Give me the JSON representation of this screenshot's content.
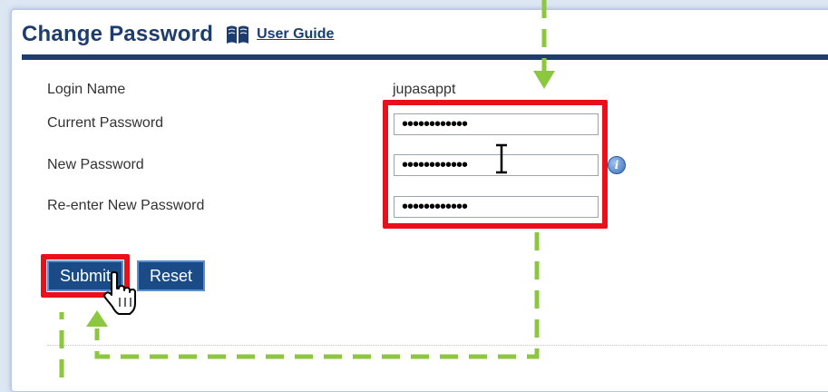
{
  "page": {
    "title": "Change Password",
    "user_guide": "User Guide"
  },
  "form": {
    "login_name_label": "Login Name",
    "login_name_value": "jupasappt",
    "current_password_label": "Current Password",
    "current_password_value": "••••••••••••",
    "new_password_label": "New Password",
    "new_password_value": "••••••••••••",
    "reenter_password_label": "Re-enter New Password",
    "reenter_password_value": "••••••••••••"
  },
  "buttons": {
    "submit": "Submit",
    "reset": "Reset"
  },
  "colors": {
    "title": "#1c3d6e",
    "header_rule": "#1c3d6e",
    "button_bg": "#1b4b86",
    "highlight": "#e8101a",
    "guide_arrow": "#8dc63f"
  },
  "icons": [
    "book-icon",
    "info-icon",
    "text-cursor-icon",
    "hand-pointer-icon",
    "arrow-down-icon",
    "arrow-up-icon"
  ]
}
